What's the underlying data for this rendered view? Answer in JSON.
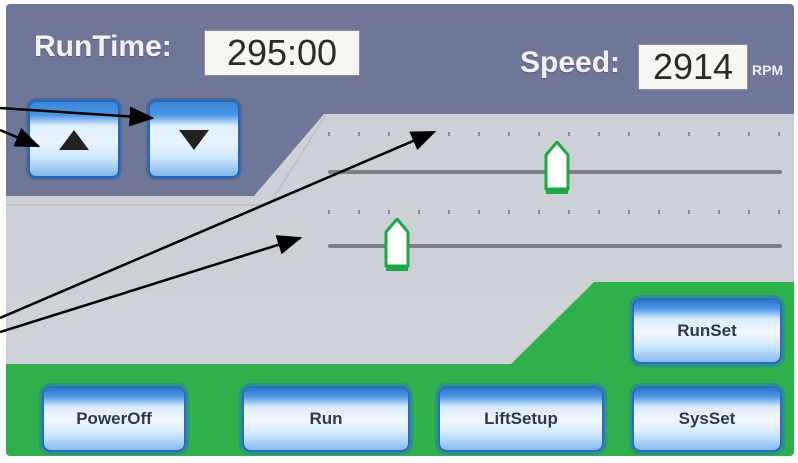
{
  "header": {
    "runtime_label": "RunTime:",
    "runtime_value": "295:00",
    "speed_label": "Speed:",
    "speed_value": "2914",
    "speed_unit": "RPM"
  },
  "arrow_buttons": {
    "up_icon": "triangle-up-icon",
    "down_icon": "triangle-down-icon"
  },
  "sliders": [
    {
      "name": "top-slider"
    },
    {
      "name": "bottom-slider"
    }
  ],
  "buttons": {
    "runset": "RunSet",
    "poweroff": "PowerOff",
    "run": "Run",
    "liftsetup": "LiftSetup",
    "sysset": "SysSet"
  },
  "colors": {
    "header_bg": "#6c7595",
    "panel_bg": "#d1d4da",
    "accent_green": "#2fb24a",
    "button_blue": "#4d96e3"
  }
}
